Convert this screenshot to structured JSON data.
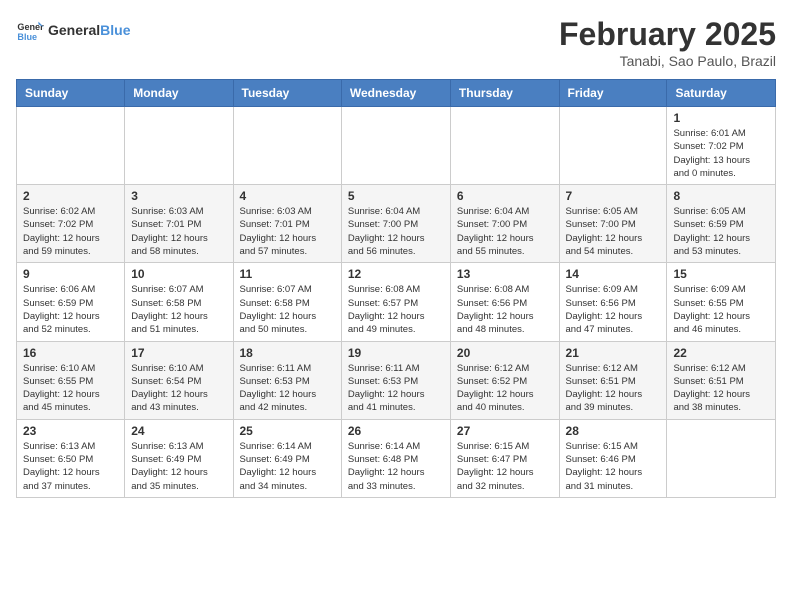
{
  "header": {
    "logo_general": "General",
    "logo_blue": "Blue",
    "month_title": "February 2025",
    "location": "Tanabi, Sao Paulo, Brazil"
  },
  "weekdays": [
    "Sunday",
    "Monday",
    "Tuesday",
    "Wednesday",
    "Thursday",
    "Friday",
    "Saturday"
  ],
  "weeks": [
    [
      {
        "day": "",
        "info": ""
      },
      {
        "day": "",
        "info": ""
      },
      {
        "day": "",
        "info": ""
      },
      {
        "day": "",
        "info": ""
      },
      {
        "day": "",
        "info": ""
      },
      {
        "day": "",
        "info": ""
      },
      {
        "day": "1",
        "info": "Sunrise: 6:01 AM\nSunset: 7:02 PM\nDaylight: 13 hours\nand 0 minutes."
      }
    ],
    [
      {
        "day": "2",
        "info": "Sunrise: 6:02 AM\nSunset: 7:02 PM\nDaylight: 12 hours\nand 59 minutes."
      },
      {
        "day": "3",
        "info": "Sunrise: 6:03 AM\nSunset: 7:01 PM\nDaylight: 12 hours\nand 58 minutes."
      },
      {
        "day": "4",
        "info": "Sunrise: 6:03 AM\nSunset: 7:01 PM\nDaylight: 12 hours\nand 57 minutes."
      },
      {
        "day": "5",
        "info": "Sunrise: 6:04 AM\nSunset: 7:00 PM\nDaylight: 12 hours\nand 56 minutes."
      },
      {
        "day": "6",
        "info": "Sunrise: 6:04 AM\nSunset: 7:00 PM\nDaylight: 12 hours\nand 55 minutes."
      },
      {
        "day": "7",
        "info": "Sunrise: 6:05 AM\nSunset: 7:00 PM\nDaylight: 12 hours\nand 54 minutes."
      },
      {
        "day": "8",
        "info": "Sunrise: 6:05 AM\nSunset: 6:59 PM\nDaylight: 12 hours\nand 53 minutes."
      }
    ],
    [
      {
        "day": "9",
        "info": "Sunrise: 6:06 AM\nSunset: 6:59 PM\nDaylight: 12 hours\nand 52 minutes."
      },
      {
        "day": "10",
        "info": "Sunrise: 6:07 AM\nSunset: 6:58 PM\nDaylight: 12 hours\nand 51 minutes."
      },
      {
        "day": "11",
        "info": "Sunrise: 6:07 AM\nSunset: 6:58 PM\nDaylight: 12 hours\nand 50 minutes."
      },
      {
        "day": "12",
        "info": "Sunrise: 6:08 AM\nSunset: 6:57 PM\nDaylight: 12 hours\nand 49 minutes."
      },
      {
        "day": "13",
        "info": "Sunrise: 6:08 AM\nSunset: 6:56 PM\nDaylight: 12 hours\nand 48 minutes."
      },
      {
        "day": "14",
        "info": "Sunrise: 6:09 AM\nSunset: 6:56 PM\nDaylight: 12 hours\nand 47 minutes."
      },
      {
        "day": "15",
        "info": "Sunrise: 6:09 AM\nSunset: 6:55 PM\nDaylight: 12 hours\nand 46 minutes."
      }
    ],
    [
      {
        "day": "16",
        "info": "Sunrise: 6:10 AM\nSunset: 6:55 PM\nDaylight: 12 hours\nand 45 minutes."
      },
      {
        "day": "17",
        "info": "Sunrise: 6:10 AM\nSunset: 6:54 PM\nDaylight: 12 hours\nand 43 minutes."
      },
      {
        "day": "18",
        "info": "Sunrise: 6:11 AM\nSunset: 6:53 PM\nDaylight: 12 hours\nand 42 minutes."
      },
      {
        "day": "19",
        "info": "Sunrise: 6:11 AM\nSunset: 6:53 PM\nDaylight: 12 hours\nand 41 minutes."
      },
      {
        "day": "20",
        "info": "Sunrise: 6:12 AM\nSunset: 6:52 PM\nDaylight: 12 hours\nand 40 minutes."
      },
      {
        "day": "21",
        "info": "Sunrise: 6:12 AM\nSunset: 6:51 PM\nDaylight: 12 hours\nand 39 minutes."
      },
      {
        "day": "22",
        "info": "Sunrise: 6:12 AM\nSunset: 6:51 PM\nDaylight: 12 hours\nand 38 minutes."
      }
    ],
    [
      {
        "day": "23",
        "info": "Sunrise: 6:13 AM\nSunset: 6:50 PM\nDaylight: 12 hours\nand 37 minutes."
      },
      {
        "day": "24",
        "info": "Sunrise: 6:13 AM\nSunset: 6:49 PM\nDaylight: 12 hours\nand 35 minutes."
      },
      {
        "day": "25",
        "info": "Sunrise: 6:14 AM\nSunset: 6:49 PM\nDaylight: 12 hours\nand 34 minutes."
      },
      {
        "day": "26",
        "info": "Sunrise: 6:14 AM\nSunset: 6:48 PM\nDaylight: 12 hours\nand 33 minutes."
      },
      {
        "day": "27",
        "info": "Sunrise: 6:15 AM\nSunset: 6:47 PM\nDaylight: 12 hours\nand 32 minutes."
      },
      {
        "day": "28",
        "info": "Sunrise: 6:15 AM\nSunset: 6:46 PM\nDaylight: 12 hours\nand 31 minutes."
      },
      {
        "day": "",
        "info": ""
      }
    ]
  ]
}
